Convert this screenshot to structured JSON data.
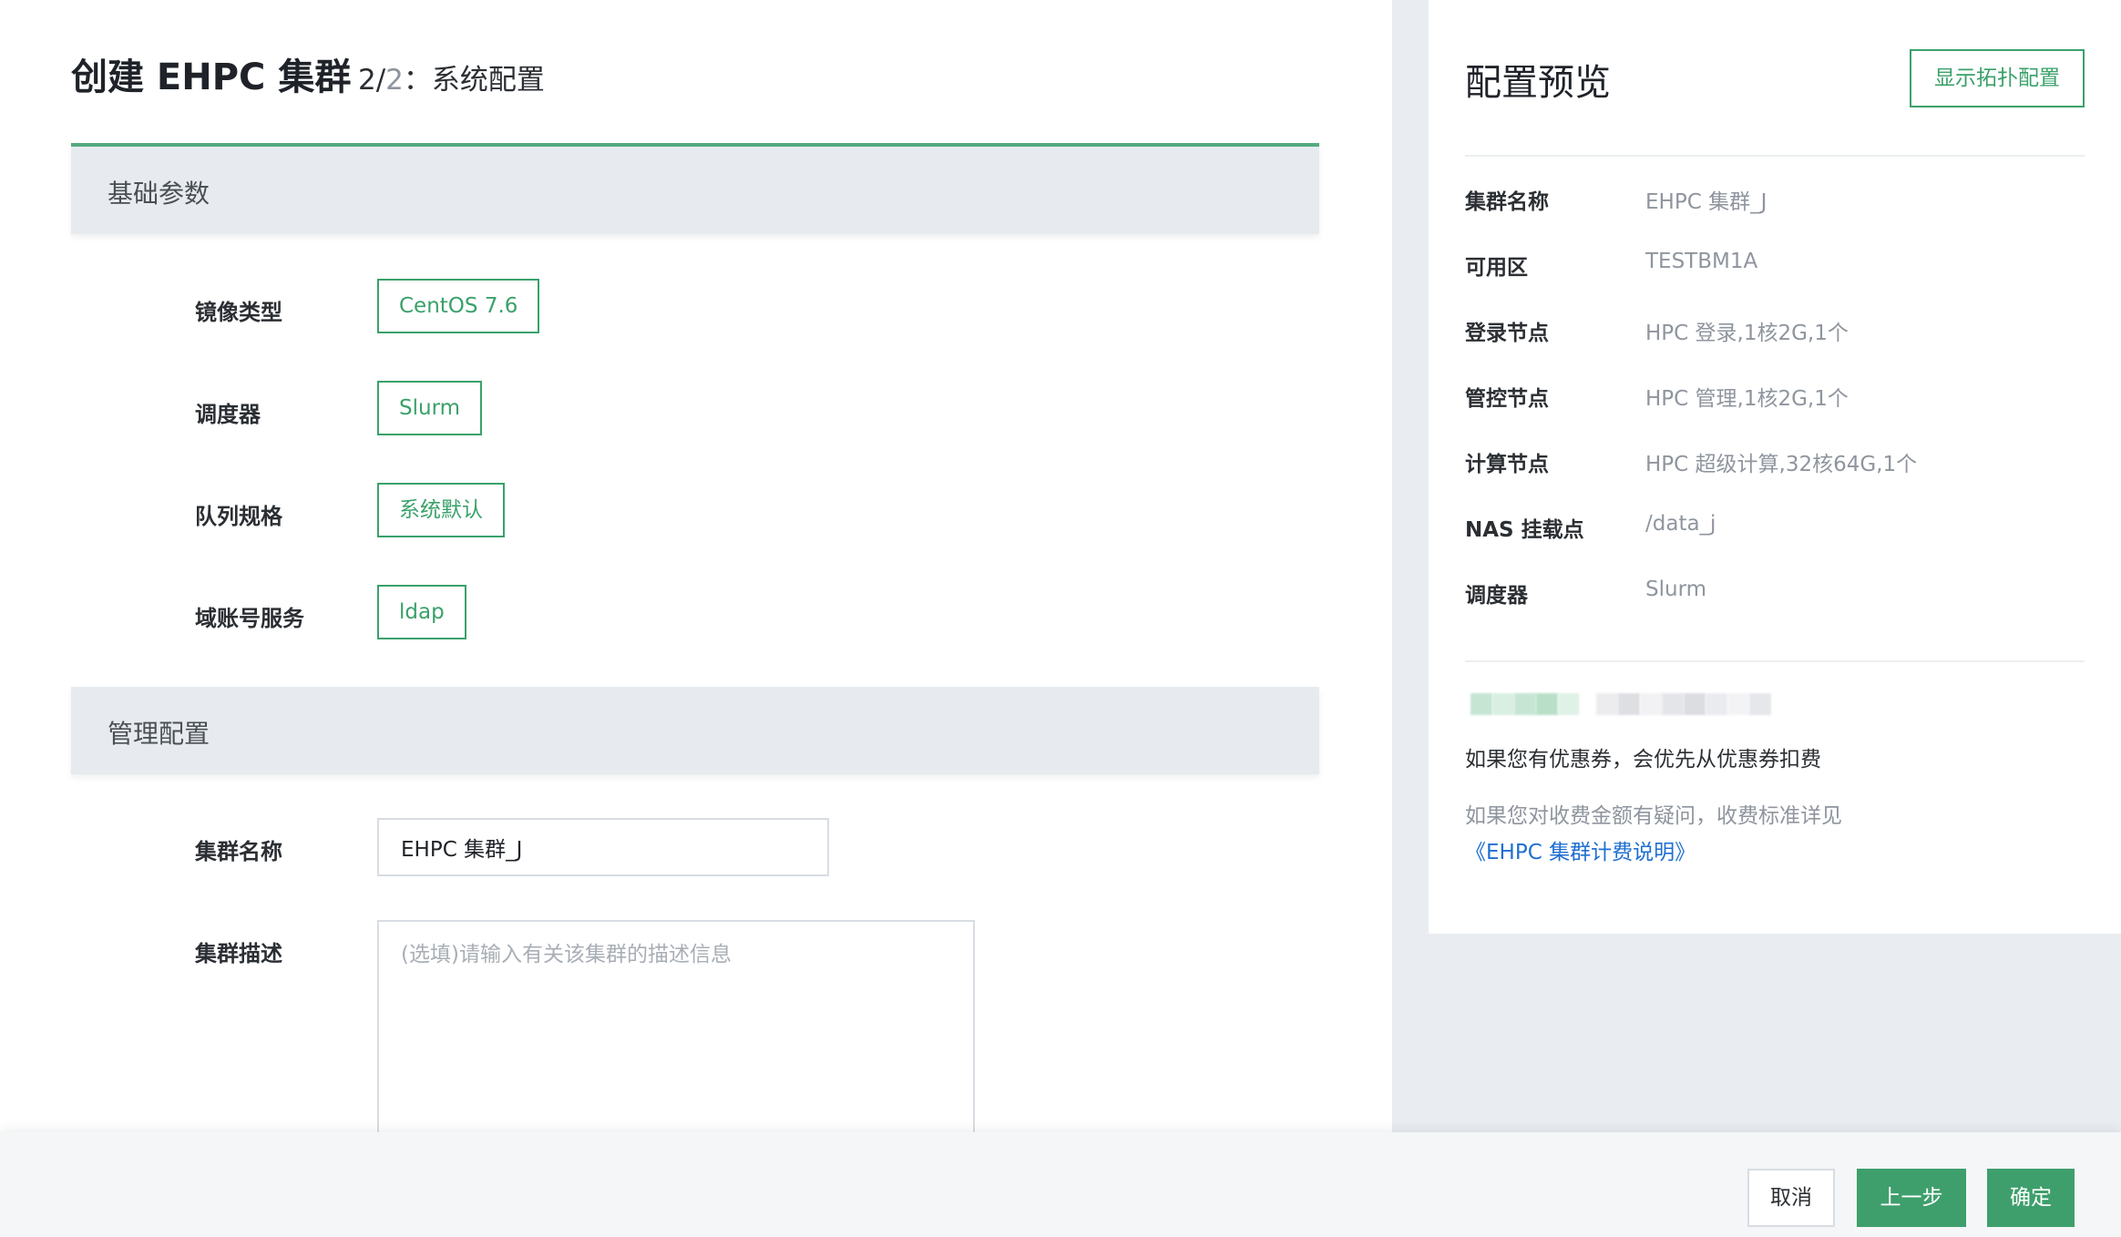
{
  "header": {
    "title": "创建 EHPC 集群",
    "step_current": "2/",
    "step_total": "2",
    "step_separator": "：",
    "step_name": "系统配置"
  },
  "basic_section": {
    "title": "基础参数",
    "fields": [
      {
        "label": "镜像类型",
        "value": "CentOS 7.6"
      },
      {
        "label": "调度器",
        "value": "Slurm"
      },
      {
        "label": "队列规格",
        "value": "系统默认"
      },
      {
        "label": "域账号服务",
        "value": "ldap"
      }
    ]
  },
  "manage_section": {
    "title": "管理配置",
    "cluster_name_label": "集群名称",
    "cluster_name_value": "EHPC 集群_J",
    "cluster_desc_label": "集群描述",
    "cluster_desc_placeholder": "(选填)请输入有关该集群的描述信息"
  },
  "preview": {
    "title": "配置预览",
    "topology_button": "显示拓扑配置",
    "items": [
      {
        "key": "集群名称",
        "value": "EHPC 集群_J"
      },
      {
        "key": "可用区",
        "value": "TESTBM1A"
      },
      {
        "key": "登录节点",
        "value": "HPC 登录,1核2G,1个"
      },
      {
        "key": "管控节点",
        "value": "HPC 管理,1核2G,1个"
      },
      {
        "key": "计算节点",
        "value": "HPC 超级计算,32核64G,1个"
      },
      {
        "key": "NAS 挂载点",
        "value": "/data_j"
      },
      {
        "key": "调度器",
        "value": "Slurm"
      }
    ],
    "coupon_note": "如果您有优惠券，会优先从优惠券扣费",
    "fee_note_prefix": "如果您对收费金额有疑问，收费标准详见",
    "fee_link": "《EHPC 集群计费说明》"
  },
  "footer": {
    "cancel": "取消",
    "prev": "上一步",
    "confirm": "确定"
  },
  "colors": {
    "accent": "#3aa16a",
    "primary_button": "#3e9f6c",
    "link": "#1f6fd0"
  }
}
